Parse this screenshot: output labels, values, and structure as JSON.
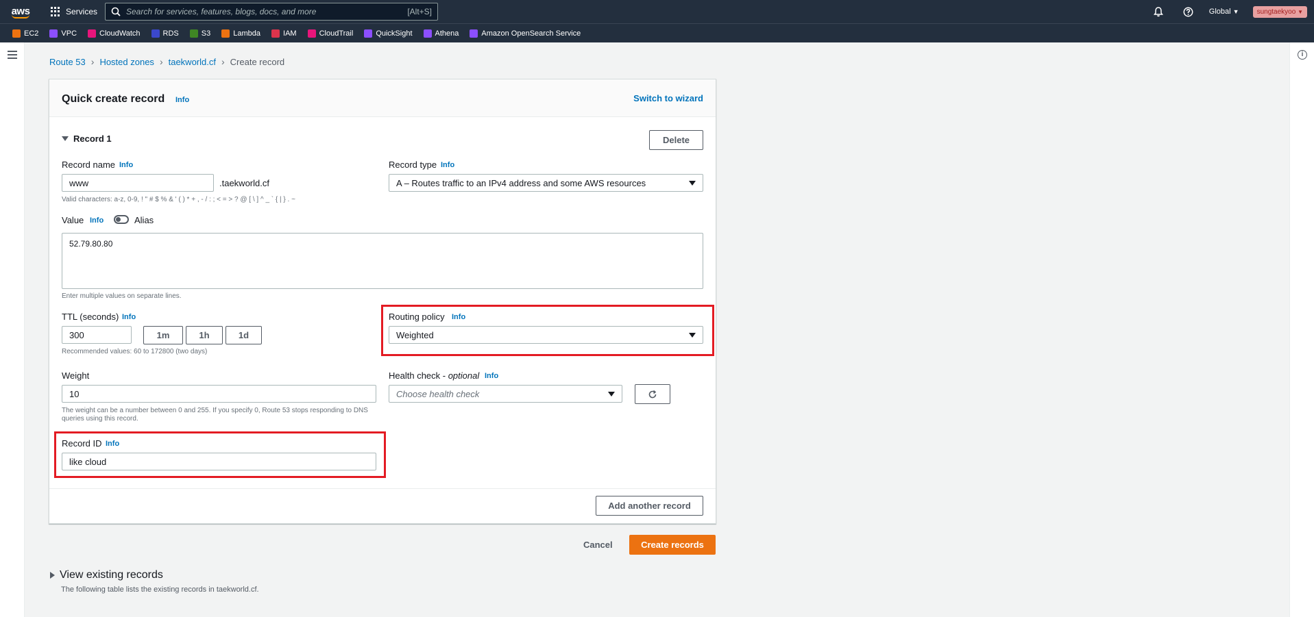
{
  "topnav": {
    "logo": "aws",
    "services_label": "Services",
    "search_placeholder": "Search for services, features, blogs, docs, and more",
    "search_shortcut": "[Alt+S]",
    "region": "Global",
    "user": "sungtaekyoo"
  },
  "favorites": [
    {
      "label": "EC2",
      "color": "#ec7211"
    },
    {
      "label": "VPC",
      "color": "#8c4fff"
    },
    {
      "label": "CloudWatch",
      "color": "#e7157b"
    },
    {
      "label": "RDS",
      "color": "#3b48cc"
    },
    {
      "label": "S3",
      "color": "#3f8624"
    },
    {
      "label": "Lambda",
      "color": "#ec7211"
    },
    {
      "label": "IAM",
      "color": "#dd344c"
    },
    {
      "label": "CloudTrail",
      "color": "#e7157b"
    },
    {
      "label": "QuickSight",
      "color": "#8c4fff"
    },
    {
      "label": "Athena",
      "color": "#8c4fff"
    },
    {
      "label": "Amazon OpenSearch Service",
      "color": "#8c4fff"
    }
  ],
  "breadcrumb": {
    "items": [
      "Route 53",
      "Hosted zones",
      "taekworld.cf"
    ],
    "current": "Create record"
  },
  "card": {
    "title": "Quick create record",
    "info": "Info",
    "switch_wizard": "Switch to wizard",
    "record_section": "Record 1",
    "delete_label": "Delete"
  },
  "form": {
    "record_name_label": "Record name",
    "record_name_value": "www",
    "domain_suffix": ".taekworld.cf",
    "record_name_hint": "Valid characters: a-z, 0-9, ! \" # $ % & ' ( ) * + , - / : ; < = > ? @ [ \\ ] ^ _ ` { | } . ~",
    "record_type_label": "Record type",
    "record_type_value": "A – Routes traffic to an IPv4 address and some AWS resources",
    "value_label": "Value",
    "alias_label": "Alias",
    "value_text": "52.79.80.80",
    "value_hint": "Enter multiple values on separate lines.",
    "ttl_label": "TTL (seconds)",
    "ttl_value": "300",
    "ttl_presets": [
      "1m",
      "1h",
      "1d"
    ],
    "ttl_hint": "Recommended values: 60 to 172800 (two days)",
    "routing_policy_label": "Routing policy",
    "routing_policy_value": "Weighted",
    "weight_label": "Weight",
    "weight_value": "10",
    "weight_hint": "The weight can be a number between 0 and 255. If you specify 0, Route 53 stops responding to DNS queries using this record.",
    "health_check_label": "Health check - ",
    "health_check_optional": "optional",
    "health_check_placeholder": "Choose health check",
    "record_id_label": "Record ID",
    "record_id_value": "like cloud",
    "info": "Info"
  },
  "footer": {
    "add_another": "Add another record",
    "cancel": "Cancel",
    "create": "Create records"
  },
  "existing": {
    "title": "View existing records",
    "description": "The following table lists the existing records in taekworld.cf."
  }
}
